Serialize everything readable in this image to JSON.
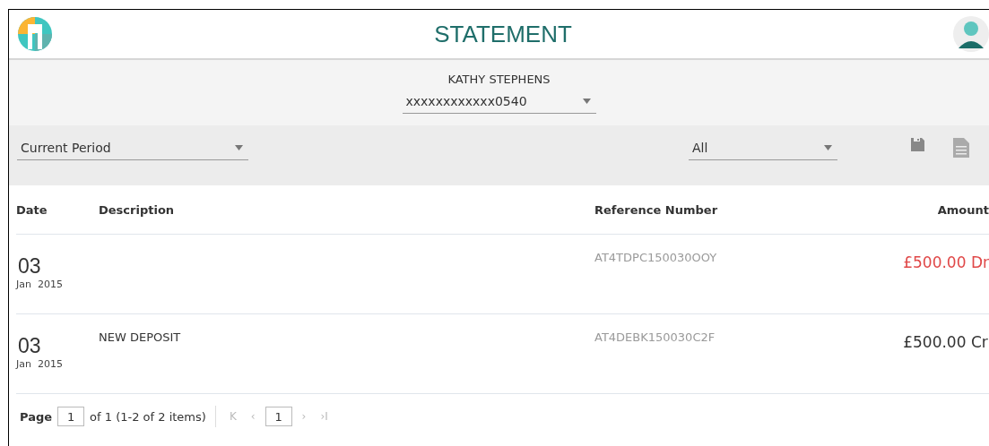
{
  "header": {
    "title": "STATEMENT"
  },
  "account": {
    "holder": "KATHY STEPHENS",
    "number": "xxxxxxxxxxxx0540"
  },
  "filters": {
    "period": "Current Period",
    "type": "All"
  },
  "table": {
    "columns": [
      "Date",
      "Description",
      "Reference Number",
      "Amount"
    ],
    "rows": [
      {
        "day": "03",
        "month_year": "Jan  2015",
        "description": "",
        "reference": "AT4TDPC150030OOY",
        "amount": "£500.00 Dr",
        "kind": "debit"
      },
      {
        "day": "03",
        "month_year": "Jan  2015",
        "description": "NEW DEPOSIT",
        "reference": "AT4DEBK150030C2F",
        "amount": "£500.00 Cr",
        "kind": "credit"
      }
    ]
  },
  "pager": {
    "label": "Page",
    "page": "1",
    "summary": "of 1 (1-2 of 2 items)",
    "first": "K",
    "prev": "‹",
    "current": "1",
    "next": "›",
    "last": "›I"
  }
}
